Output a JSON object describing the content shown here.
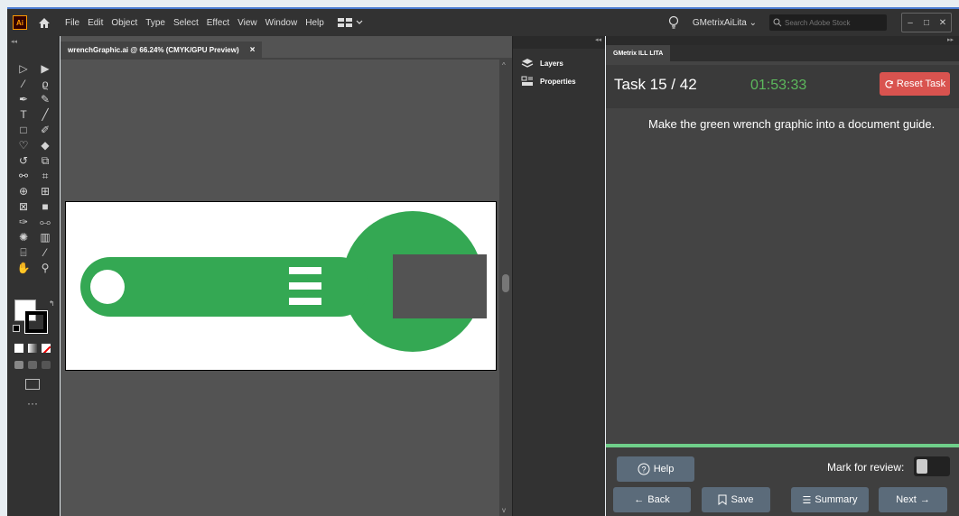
{
  "app": {
    "logo_text": "Ai",
    "menu": [
      "File",
      "Edit",
      "Object",
      "Type",
      "Select",
      "Effect",
      "View",
      "Window",
      "Help"
    ],
    "account_name": "GMetrixAiLita",
    "search_placeholder": "Search Adobe Stock"
  },
  "document": {
    "tab_title": "wrenchGraphic.ai @ 66.24% (CMYK/GPU Preview)",
    "tab_close": "×"
  },
  "dock": {
    "items": [
      {
        "label": "Layers",
        "icon": "layers-icon"
      },
      {
        "label": "Properties",
        "icon": "properties-icon"
      }
    ]
  },
  "gmetrix": {
    "tab_label": "GMetrix ILL LITA",
    "task_label": "Task 15 / 42",
    "timer": "01:53:33",
    "reset_label": "Reset Task",
    "task_text": "Make the green wrench graphic into a document guide.",
    "help_label": "Help",
    "mark_review_label": "Mark for review:",
    "back_label": "Back",
    "save_label": "Save",
    "summary_label": "Summary",
    "next_label": "Next"
  },
  "colors": {
    "wrench_green": "#34a853",
    "wrench_gray": "#535353",
    "timer_green": "#5cb85c",
    "reset_red": "#d9534f",
    "accent_bar": "#6fcf8a"
  }
}
